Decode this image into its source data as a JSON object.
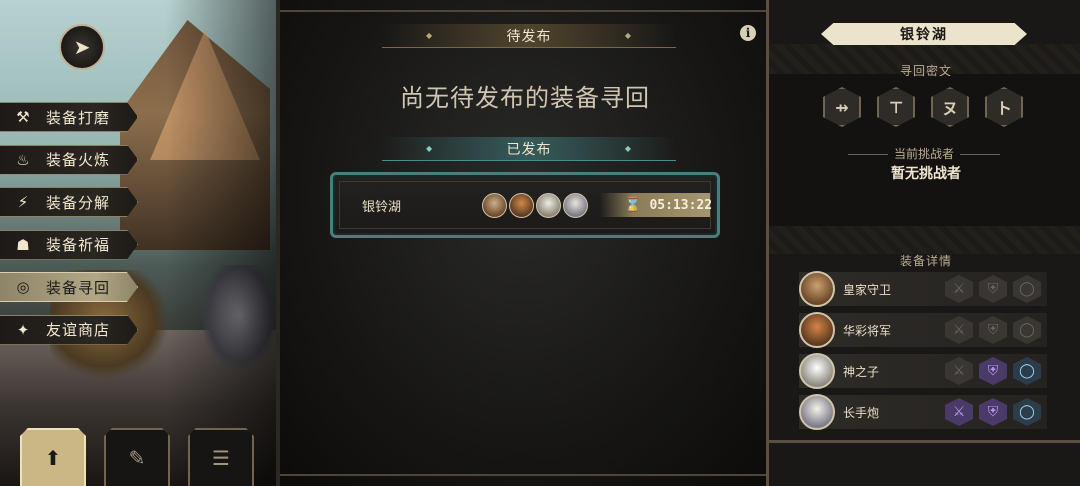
{
  "left_menu": {
    "items": [
      {
        "label": "装备打磨",
        "icon": "hammer-icon",
        "glyph": "⚒",
        "active": false
      },
      {
        "label": "装备火炼",
        "icon": "flame-icon",
        "glyph": "♨",
        "active": false
      },
      {
        "label": "装备分解",
        "icon": "disassemble-icon",
        "glyph": "⚡",
        "active": false
      },
      {
        "label": "装备祈福",
        "icon": "blessing-icon",
        "glyph": "☗",
        "active": false
      },
      {
        "label": "装备寻回",
        "icon": "retrieve-icon",
        "glyph": "◎",
        "active": true
      },
      {
        "label": "友谊商店",
        "icon": "fox-icon",
        "glyph": "✦",
        "active": false
      }
    ]
  },
  "middle": {
    "pending_header": "待发布",
    "empty_message": "尚无待发布的装备寻回",
    "published_header": "已发布",
    "quest": {
      "name": "银铃湖",
      "timer": "05:13:22"
    }
  },
  "right": {
    "location_title": "银铃湖",
    "cipher_label": "寻回密文",
    "runes": [
      "⇸",
      "⊤",
      "ヌ",
      "ト"
    ],
    "challenger_label": "当前挑战者",
    "challenger_value": "暂无挑战者",
    "equipment_label": "装备详情",
    "equipment": [
      {
        "name": "皇家守卫",
        "weapon": false,
        "armor": false,
        "ring": false
      },
      {
        "name": "华彩将军",
        "weapon": false,
        "armor": false,
        "ring": false
      },
      {
        "name": "神之子",
        "weapon": false,
        "armor": true,
        "ring": true
      },
      {
        "name": "长手炮",
        "weapon": true,
        "armor": true,
        "ring": true
      }
    ]
  },
  "colors": {
    "accent_teal": "#4b7d7c",
    "gold": "#a59670",
    "equipped_purple": "#b89ae8",
    "equipped_ring": "#9ed8f0"
  }
}
